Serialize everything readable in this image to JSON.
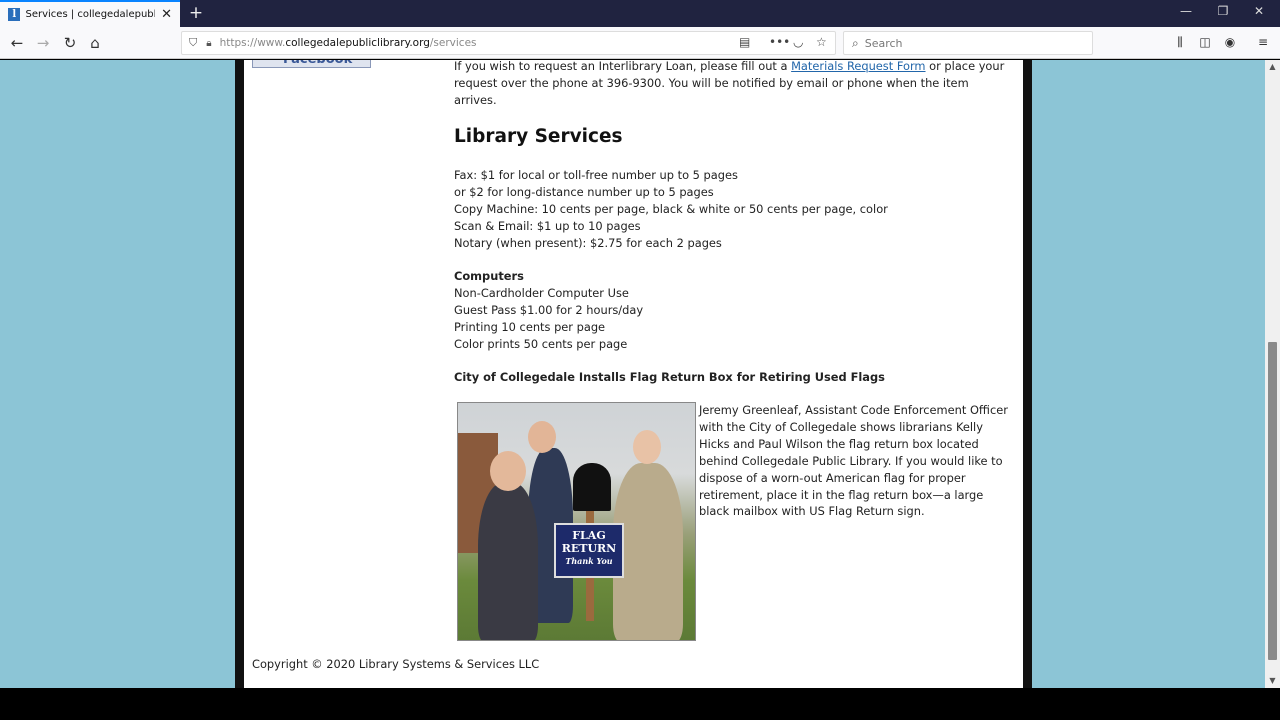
{
  "browser": {
    "tab_title": "Services | collegedalepublicli",
    "favicon_letter": "l",
    "new_tab_symbol": "+",
    "url_prefix": "https://www.",
    "url_host": "collegedalepubliclibrary.org",
    "url_path": "/services",
    "search_placeholder": "Search"
  },
  "page": {
    "facebook_label": "Facebook",
    "intro_text_before": "If you wish to request an Interlibrary Loan, please fill out a ",
    "intro_link": "Materials Request Form",
    "intro_text_after": " or place your request over the phone at 396-9300. You will be notified by email or phone when the item arrives.",
    "services_title": "Library Services",
    "services": [
      "Fax: $1 for local or toll-free number up to 5 pages",
      "or $2 for long-distance number up to 5 pages",
      "Copy Machine: 10 cents per page, black & white or 50 cents per page, color",
      "Scan & Email: $1 up to 10 pages",
      "Notary (when present): $2.75 for each 2 pages"
    ],
    "computers_title": "Computers",
    "computers": [
      "Non-Cardholder Computer Use",
      "Guest Pass $1.00 for 2 hours/day",
      "Printing 10 cents per page",
      "Color prints 50 cents per page"
    ],
    "flag_title": "City of Collegedale Installs Flag Return Box for Retiring Used Flags",
    "photo_sign_line1": "FLAG",
    "photo_sign_line2": "RETURN",
    "photo_sign_line3": "Thank You",
    "flag_caption": "Jeremy Greenleaf, Assistant Code Enforcement Officer with the City of Collegedale shows librarians Kelly Hicks and Paul Wilson the flag return box located behind Collegedale Public Library. If you would like to dispose of a worn-out American flag for proper retirement, place it in the flag return box—a large black mailbox with US Flag Return sign.",
    "footer": "Copyright © 2020 Library Systems & Services LLC"
  },
  "colors": {
    "side_background": "#8cc5d6",
    "link": "#2266aa",
    "tab_accent": "#0a84ff"
  },
  "icons": [
    "back-icon",
    "forward-icon",
    "reload-icon",
    "home-icon",
    "shield-icon",
    "lock-icon",
    "reader-view-icon",
    "more-icon",
    "pocket-icon",
    "bookmark-star-icon",
    "search-icon",
    "library-icon",
    "sidebar-icon",
    "account-icon",
    "menu-icon"
  ]
}
